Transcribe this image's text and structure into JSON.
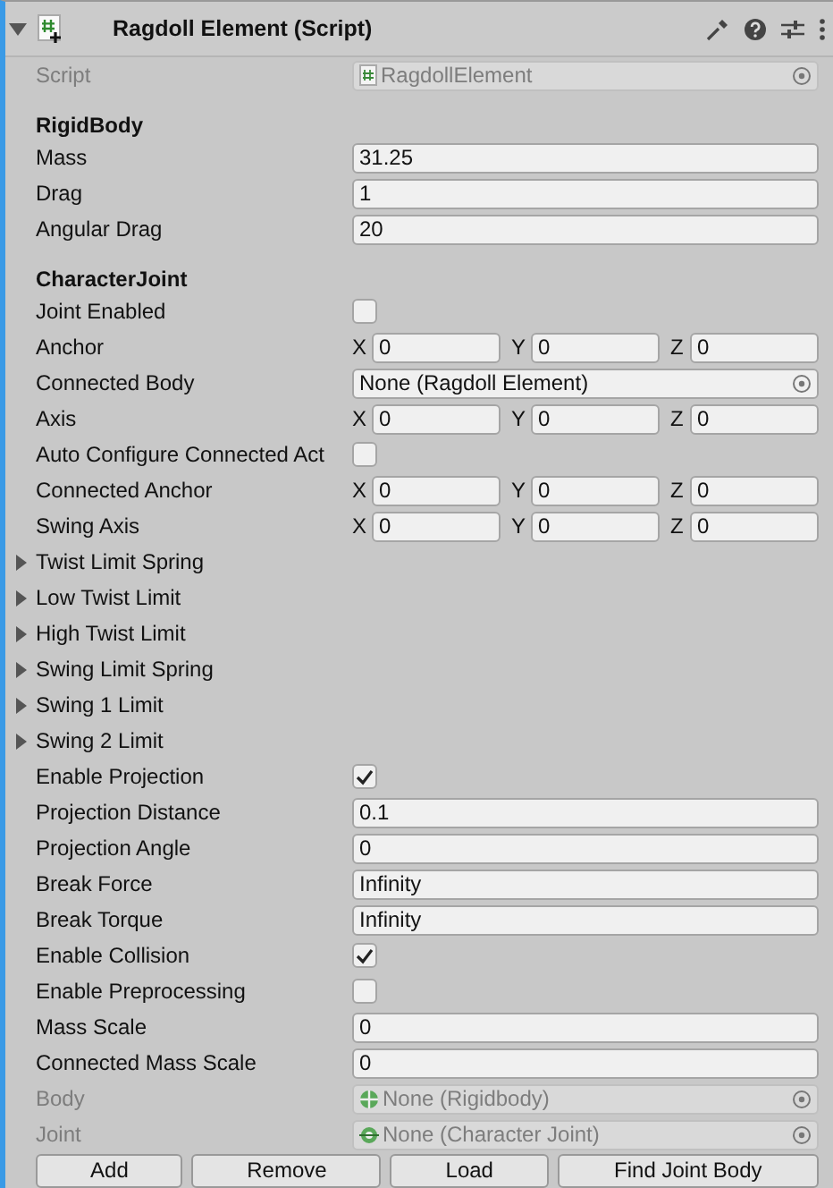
{
  "component": {
    "title": "Ragdoll Element (Script)",
    "expanded": true
  },
  "rows": [
    {
      "kind": "script",
      "label": "Script",
      "value": "RagdollElement",
      "disabled": true
    },
    {
      "kind": "header",
      "label": "RigidBody"
    },
    {
      "kind": "text",
      "label": "Mass",
      "value": "31.25"
    },
    {
      "kind": "text",
      "label": "Drag",
      "value": "1"
    },
    {
      "kind": "text",
      "label": "Angular Drag",
      "value": "20"
    },
    {
      "kind": "header",
      "label": "CharacterJoint"
    },
    {
      "kind": "toggle",
      "label": "Joint Enabled",
      "checked": false
    },
    {
      "kind": "vector",
      "label": "Anchor",
      "axes": [
        {
          "axis": "X",
          "value": "0"
        },
        {
          "axis": "Y",
          "value": "0"
        },
        {
          "axis": "Z",
          "value": "0"
        }
      ]
    },
    {
      "kind": "object",
      "label": "Connected Body",
      "value": "None (Ragdoll Element)",
      "disabled": false
    },
    {
      "kind": "vector",
      "label": "Axis",
      "axes": [
        {
          "axis": "X",
          "value": "0"
        },
        {
          "axis": "Y",
          "value": "0"
        },
        {
          "axis": "Z",
          "value": "0"
        }
      ]
    },
    {
      "kind": "toggle",
      "label": "Auto Configure Connected Act",
      "checked": false
    },
    {
      "kind": "vector",
      "label": "Connected Anchor",
      "axes": [
        {
          "axis": "X",
          "value": "0"
        },
        {
          "axis": "Y",
          "value": "0"
        },
        {
          "axis": "Z",
          "value": "0"
        }
      ]
    },
    {
      "kind": "vector",
      "label": "Swing Axis",
      "axes": [
        {
          "axis": "X",
          "value": "0"
        },
        {
          "axis": "Y",
          "value": "0"
        },
        {
          "axis": "Z",
          "value": "0"
        }
      ]
    },
    {
      "kind": "foldout",
      "label": "Twist Limit Spring",
      "expanded": false
    },
    {
      "kind": "foldout",
      "label": "Low Twist Limit",
      "expanded": false
    },
    {
      "kind": "foldout",
      "label": "High Twist Limit",
      "expanded": false
    },
    {
      "kind": "foldout",
      "label": "Swing Limit Spring",
      "expanded": false
    },
    {
      "kind": "foldout",
      "label": "Swing 1 Limit",
      "expanded": false
    },
    {
      "kind": "foldout",
      "label": "Swing 2 Limit",
      "expanded": false
    },
    {
      "kind": "toggle",
      "label": "Enable Projection",
      "checked": true
    },
    {
      "kind": "text",
      "label": "Projection Distance",
      "value": "0.1"
    },
    {
      "kind": "text",
      "label": "Projection Angle",
      "value": "0"
    },
    {
      "kind": "text",
      "label": "Break Force",
      "value": "Infinity"
    },
    {
      "kind": "text",
      "label": "Break Torque",
      "value": "Infinity"
    },
    {
      "kind": "toggle",
      "label": "Enable Collision",
      "checked": true
    },
    {
      "kind": "toggle",
      "label": "Enable Preprocessing",
      "checked": false
    },
    {
      "kind": "text",
      "label": "Mass Scale",
      "value": "0"
    },
    {
      "kind": "text",
      "label": "Connected Mass Scale",
      "value": "0"
    },
    {
      "kind": "rigidbody",
      "label": "Body",
      "value": "None (Rigidbody)",
      "disabled": true
    },
    {
      "kind": "joint",
      "label": "Joint",
      "value": "None (Character Joint)",
      "disabled": true
    }
  ],
  "buttons": [
    "Add",
    "Remove",
    "Load",
    "Find Joint Body"
  ]
}
